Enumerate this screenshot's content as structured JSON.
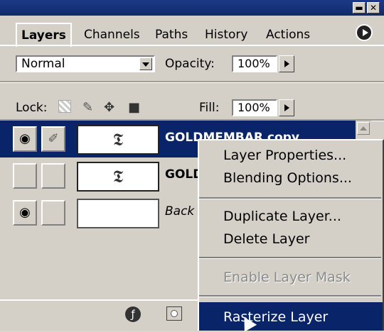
{
  "window": {
    "minimize_label": "▬",
    "close_label": "✕"
  },
  "tabs": [
    {
      "label": "Layers"
    },
    {
      "label": "Channels"
    },
    {
      "label": "Paths"
    },
    {
      "label": "History"
    },
    {
      "label": "Actions"
    }
  ],
  "blend": {
    "mode": "Normal",
    "opacity_label": "Opacity:",
    "opacity_value": "100%"
  },
  "lock": {
    "label": "Lock:",
    "fill_label": "Fill:",
    "fill_value": "100%"
  },
  "layers": [
    {
      "name": "GOLDMEMBAR copy",
      "visible": true,
      "brush": true,
      "selected": true
    },
    {
      "name": "GOLD",
      "visible": false,
      "brush": false,
      "selected": false
    },
    {
      "name": "Back",
      "visible": true,
      "brush": false,
      "selected": false
    }
  ],
  "context_menu": {
    "items": [
      {
        "label": "Layer Properties..."
      },
      {
        "label": "Blending Options..."
      },
      {
        "label": "Duplicate Layer..."
      },
      {
        "label": "Delete Layer"
      },
      {
        "label": "Enable Layer Mask"
      },
      {
        "label": "Rasterize Layer"
      }
    ]
  },
  "colors": {
    "titlebar": "#102a6a",
    "selection": "#0a246a",
    "panel": "#d4d0c8"
  }
}
